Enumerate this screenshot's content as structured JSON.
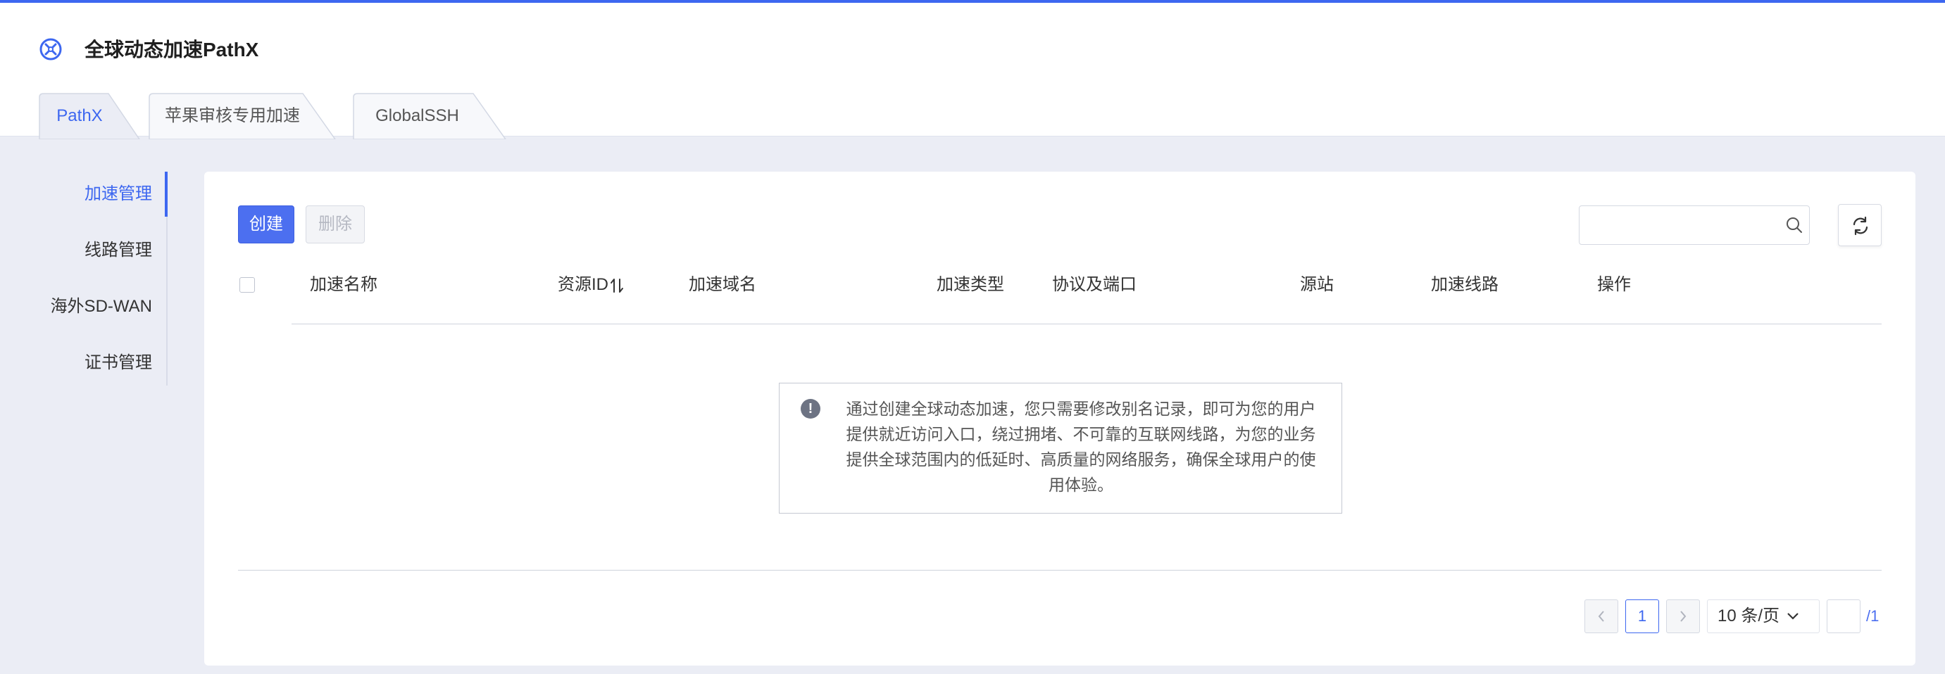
{
  "header": {
    "title": "全球动态加速PathX",
    "logo_icon": "pathx-logo-icon"
  },
  "tabs": [
    {
      "label": "PathX",
      "active": true
    },
    {
      "label": "苹果审核专用加速",
      "active": false
    },
    {
      "label": "GlobalSSH",
      "active": false
    }
  ],
  "sidebar": {
    "items": [
      {
        "label": "加速管理",
        "active": true
      },
      {
        "label": "线路管理",
        "active": false
      },
      {
        "label": "海外SD-WAN",
        "active": false
      },
      {
        "label": "证书管理",
        "active": false
      }
    ]
  },
  "toolbar": {
    "create_label": "创建",
    "delete_label": "删除",
    "search_placeholder": "",
    "search_icon": "search-icon",
    "refresh_icon": "refresh-icon"
  },
  "table": {
    "columns": [
      "加速名称",
      "资源ID",
      "加速域名",
      "加速类型",
      "协议及端口",
      "源站",
      "加速线路",
      "操作"
    ],
    "rows": []
  },
  "empty": {
    "icon": "info-icon",
    "message": "通过创建全球动态加速，您只需要修改别名记录，即可为您的用户提供就近访问入口，绕过拥堵、不可靠的互联网线路，为您的业务提供全球范围内的低延时、高质量的网络服务，确保全球用户的使用体验。"
  },
  "pagination": {
    "current": "1",
    "page_size": "10 条/页",
    "total": "/1"
  },
  "colors": {
    "accent": "#3d67f0",
    "button": "#4c6ff0",
    "background": "#ebedf5"
  }
}
